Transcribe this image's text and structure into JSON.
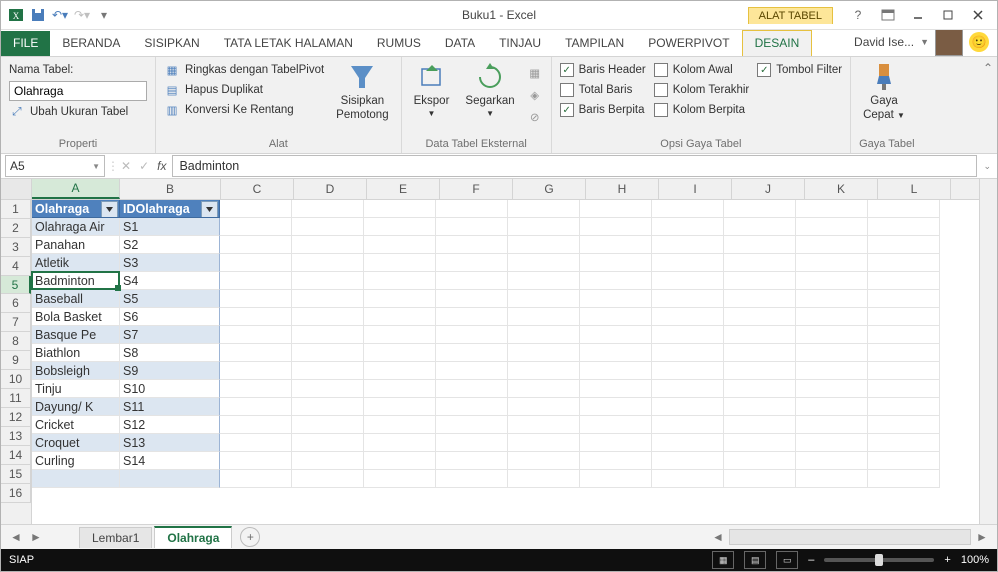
{
  "title": "Buku1 - Excel",
  "tool_context": "ALAT TABEL",
  "tabs": {
    "file": "FILE",
    "beranda": "BERANDA",
    "sisipkan": "SISIPKAN",
    "tataletak": "TATA LETAK HALAMAN",
    "rumus": "RUMUS",
    "data": "DATA",
    "tinjau": "TINJAU",
    "tampilan": "TAMPILAN",
    "powerpivot": "POWERPIVOT",
    "desain": "DESAIN"
  },
  "user": "David Ise...",
  "ribbon": {
    "properti": {
      "label": "Properti",
      "nama_tabel_lbl": "Nama Tabel:",
      "nama_tabel_val": "Olahraga",
      "ubah_ukuran": "Ubah Ukuran Tabel"
    },
    "alat": {
      "label": "Alat",
      "ringkas": "Ringkas dengan TabelPivot",
      "hapus": "Hapus Duplikat",
      "konversi": "Konversi Ke Rentang",
      "pemotong_a": "Sisipkan",
      "pemotong_b": "Pemotong"
    },
    "eksternal": {
      "label": "Data Tabel Eksternal",
      "ekspor": "Ekspor",
      "segarkan": "Segarkan"
    },
    "opsi": {
      "label": "Opsi Gaya Tabel",
      "baris_header": "Baris Header",
      "total": "Total Baris",
      "berpita": "Baris Berpita",
      "kolom_awal": "Kolom Awal",
      "kolom_akhir": "Kolom Terakhir",
      "kolom_berpita": "Kolom Berpita",
      "tombol_filter": "Tombol Filter"
    },
    "gaya": {
      "label": "Gaya Tabel",
      "gaya_a": "Gaya",
      "gaya_b": "Cepat"
    }
  },
  "namebox": "A5",
  "formula": "Badminton",
  "columns": [
    "A",
    "B",
    "C",
    "D",
    "E",
    "F",
    "G",
    "H",
    "I",
    "J",
    "K",
    "L"
  ],
  "col_widths": {
    "A": 88,
    "B": 100,
    "other": 72
  },
  "headers": {
    "c1": "Olahraga",
    "c2": "IDOlahraga"
  },
  "rows": [
    {
      "r": 2,
      "a": "Olahraga Air",
      "b": "S1"
    },
    {
      "r": 3,
      "a": "Panahan",
      "b": "S2"
    },
    {
      "r": 4,
      "a": "Atletik",
      "b": "S3"
    },
    {
      "r": 5,
      "a": "Badminton",
      "b": "S4"
    },
    {
      "r": 6,
      "a": "Baseball",
      "b": "S5"
    },
    {
      "r": 7,
      "a": "Bola Basket",
      "b": "S6"
    },
    {
      "r": 8,
      "a": "Basque Pe",
      "b": "S7"
    },
    {
      "r": 9,
      "a": "Biathlon",
      "b": "S8"
    },
    {
      "r": 10,
      "a": "Bobsleigh",
      "b": "S9"
    },
    {
      "r": 11,
      "a": "Tinju",
      "b": "S10"
    },
    {
      "r": 12,
      "a": "Dayung/ K",
      "b": "S11"
    },
    {
      "r": 13,
      "a": "Cricket",
      "b": "S12"
    },
    {
      "r": 14,
      "a": "Croquet",
      "b": "S13"
    },
    {
      "r": 15,
      "a": "Curling",
      "b": "S14"
    }
  ],
  "visible_row_count": 16,
  "active": {
    "row": 5,
    "col": "A"
  },
  "sheets": {
    "s1": "Lembar1",
    "s2": "Olahraga"
  },
  "status": "SIAP",
  "zoom": "100%"
}
